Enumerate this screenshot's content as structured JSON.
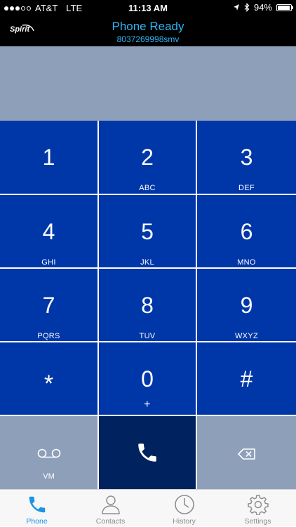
{
  "status_bar": {
    "carrier": "AT&T",
    "network": "LTE",
    "time": "11:13 AM",
    "battery": "94%",
    "battery_level": 0.94,
    "signal_bars_filled": 3,
    "signal_bars_total": 5
  },
  "header": {
    "logo_text": "Spirit",
    "title": "Phone Ready",
    "subtitle": "8037269998smv",
    "title_color": "#2fb3f2"
  },
  "keypad": {
    "key_color": "#0037a8",
    "keys": [
      {
        "digit": "1",
        "letters": ""
      },
      {
        "digit": "2",
        "letters": "ABC"
      },
      {
        "digit": "3",
        "letters": "DEF"
      },
      {
        "digit": "4",
        "letters": "GHI"
      },
      {
        "digit": "5",
        "letters": "JKL"
      },
      {
        "digit": "6",
        "letters": "MNO"
      },
      {
        "digit": "7",
        "letters": "PQRS"
      },
      {
        "digit": "8",
        "letters": "TUV"
      },
      {
        "digit": "9",
        "letters": "WXYZ"
      },
      {
        "digit": "*",
        "letters": ""
      },
      {
        "digit": "0",
        "letters": "+"
      },
      {
        "digit": "#",
        "letters": ""
      }
    ],
    "voicemail_label": "VM",
    "call_icon": "phone-icon",
    "backspace_icon": "backspace-icon"
  },
  "tabs": [
    {
      "label": "Phone",
      "icon": "phone-icon",
      "active": true
    },
    {
      "label": "Contacts",
      "icon": "person-icon",
      "active": false
    },
    {
      "label": "History",
      "icon": "clock-icon",
      "active": false
    },
    {
      "label": "Settings",
      "icon": "gear-icon",
      "active": false
    }
  ]
}
